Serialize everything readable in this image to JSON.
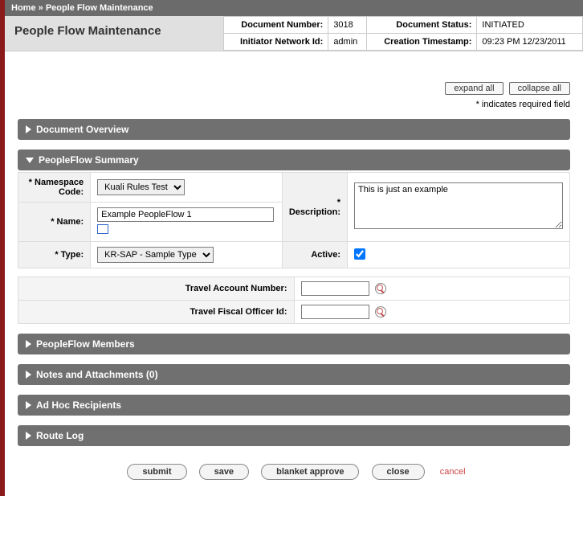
{
  "breadcrumb": {
    "home": "Home",
    "sep": "»",
    "current": "People Flow Maintenance"
  },
  "page_title": "People Flow Maintenance",
  "doc_info": {
    "doc_number_label": "Document Number:",
    "doc_number": "3018",
    "doc_status_label": "Document Status:",
    "doc_status": "INITIATED",
    "initiator_label": "Initiator Network Id:",
    "initiator": "admin",
    "timestamp_label": "Creation Timestamp:",
    "timestamp": "09:23 PM 12/23/2011"
  },
  "controls": {
    "expand_all": "expand all",
    "collapse_all": "collapse all"
  },
  "required_note": "* indicates required field",
  "sections": {
    "doc_overview": "Document Overview",
    "summary": "PeopleFlow Summary",
    "members": "PeopleFlow Members",
    "notes": "Notes and Attachments (0)",
    "adhoc": "Ad Hoc Recipients",
    "route": "Route Log"
  },
  "summary": {
    "namespace_label": "* Namespace Code:",
    "namespace_value": "Kuali Rules Test",
    "name_label": "* Name:",
    "name_value": "Example PeopleFlow 1",
    "type_label": "* Type:",
    "type_value": "KR-SAP - Sample Type",
    "description_label": "* Description:",
    "description_value": "This is just an example",
    "active_label": "Active:"
  },
  "attrs": {
    "account_label": "Travel Account Number:",
    "account_value": "",
    "officer_label": "Travel Fiscal Officer Id:",
    "officer_value": ""
  },
  "buttons": {
    "submit": "submit",
    "save": "save",
    "blanket": "blanket approve",
    "close": "close",
    "cancel": "cancel"
  }
}
